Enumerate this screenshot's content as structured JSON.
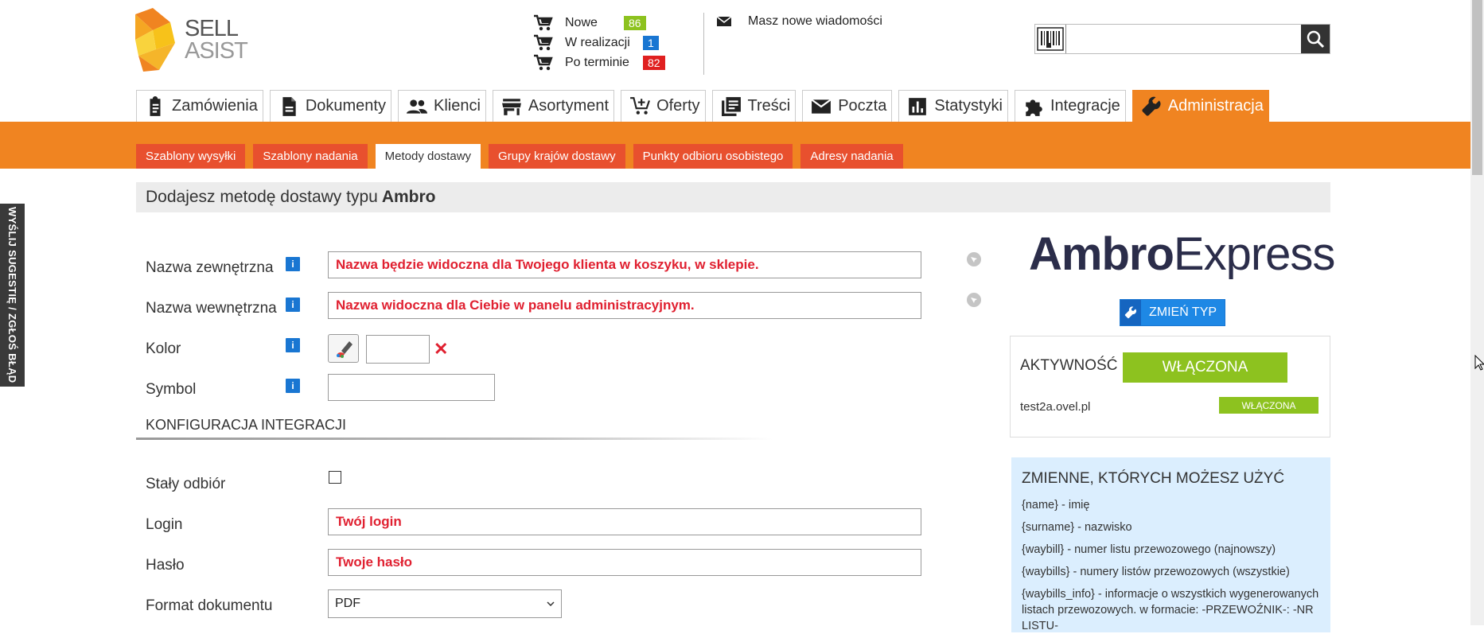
{
  "logo": {
    "line1": "SELL",
    "line2": "ASIST"
  },
  "status": [
    {
      "label": "Nowe",
      "count": "86",
      "color": "#8dc21f"
    },
    {
      "label": "W realizacji",
      "count": "1",
      "color": "#1976d2"
    },
    {
      "label": "Po terminie",
      "count": "82",
      "color": "#e02020"
    }
  ],
  "messages": {
    "text": "Masz nowe wiadomości",
    "icon": "envelope-icon"
  },
  "search": {
    "value": "",
    "icon": "search-icon",
    "barcode_icon": "barcode-icon"
  },
  "nav": [
    {
      "label": "Zamówienia",
      "icon": "clipboard-icon"
    },
    {
      "label": "Dokumenty",
      "icon": "document-icon"
    },
    {
      "label": "Klienci",
      "icon": "people-icon"
    },
    {
      "label": "Asortyment",
      "icon": "store-icon"
    },
    {
      "label": "Oferty",
      "icon": "cart-plus-icon"
    },
    {
      "label": "Treści",
      "icon": "library-icon"
    },
    {
      "label": "Poczta",
      "icon": "mail-icon"
    },
    {
      "label": "Statystyki",
      "icon": "chart-icon"
    },
    {
      "label": "Integracje",
      "icon": "puzzle-icon"
    },
    {
      "label": "Administracja",
      "icon": "wrench-icon",
      "active": true
    }
  ],
  "subnav": [
    {
      "label": "Szablony wysyłki"
    },
    {
      "label": "Szablony nadania"
    },
    {
      "label": "Metody dostawy",
      "active": true
    },
    {
      "label": "Grupy krajów dostawy"
    },
    {
      "label": "Punkty odbioru osobistego"
    },
    {
      "label": "Adresy nadania"
    }
  ],
  "side_tab": "WYŚLIJ SUGESTIĘ / ZGŁOŚ BŁĄD",
  "header": {
    "prefix": "Dodajesz metodę dostawy typu",
    "type": "Ambro"
  },
  "form": {
    "external_name_label": "Nazwa zewnętrzna",
    "external_name_value": "Nazwa będzie widoczna dla Twojego klienta w koszyku, w sklepie.",
    "internal_name_label": "Nazwa wewnętrzna",
    "internal_name_value": "Nazwa widoczna dla Ciebie w panelu administracyjnym.",
    "color_label": "Kolor",
    "color_value": "",
    "symbol_label": "Symbol",
    "symbol_value": "",
    "info_glyph": "i",
    "section_title": "KONFIGURACJA INTEGRACJI",
    "fixed_pickup_label": "Stały odbiór",
    "login_label": "Login",
    "login_value": "Twój login",
    "password_label": "Hasło",
    "password_value": "Twoje hasło",
    "format_label": "Format dokumentu",
    "format_value": "PDF"
  },
  "right": {
    "carrier_logo": {
      "bold": "Ambro",
      "light": "Express"
    },
    "change_type": "ZMIEŃ TYP",
    "activity_label": "AKTYWNOŚĆ",
    "activity_state": "WŁĄCZONA",
    "domain": "test2a.ovel.pl",
    "domain_state": "WŁĄCZONA",
    "variables_title": "ZMIENNE, KTÓRYCH MOŻESZ UŻYĆ",
    "variables": [
      "{name} - imię",
      "{surname} - nazwisko",
      "{waybill} - numer listu przewozowego (najnowszy)",
      "{waybills} - numery listów przewozowych (wszystkie)",
      "{waybills_info} - informacje o wszystkich wygenerowanych listach przewozowych. w formacie: -PRZEWOŹNIK-: -NR LISTU-"
    ]
  }
}
